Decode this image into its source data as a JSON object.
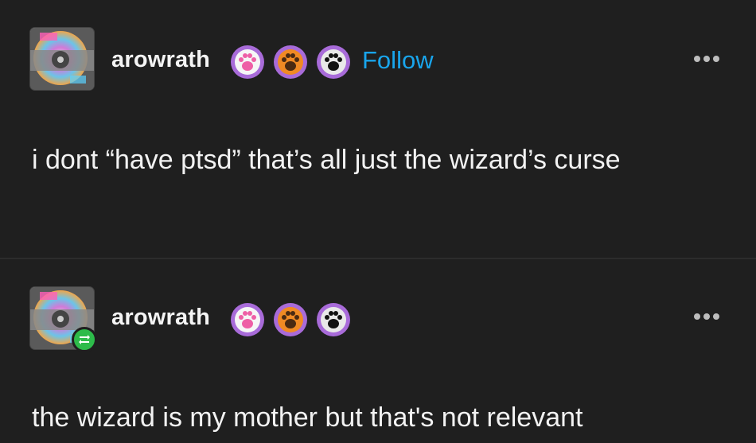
{
  "posts": [
    {
      "username": "arowrath",
      "follow_label": "Follow",
      "badges": [
        "pink-paw-badge-icon",
        "orange-paw-badge-icon",
        "black-paw-badge-icon"
      ],
      "text": "i dont “have ptsd” that’s all just the wizard’s curse",
      "reblogged": false
    },
    {
      "username": "arowrath",
      "badges": [
        "pink-paw-badge-icon",
        "orange-paw-badge-icon",
        "black-paw-badge-icon"
      ],
      "text": "the wizard is my mother but that's not relevant",
      "reblogged": true
    }
  ],
  "colors": {
    "background": "#1f1f1f",
    "follow": "#19a5ec",
    "reblog_badge": "#2dbb4a",
    "badge_ring": "#a86bd9"
  }
}
